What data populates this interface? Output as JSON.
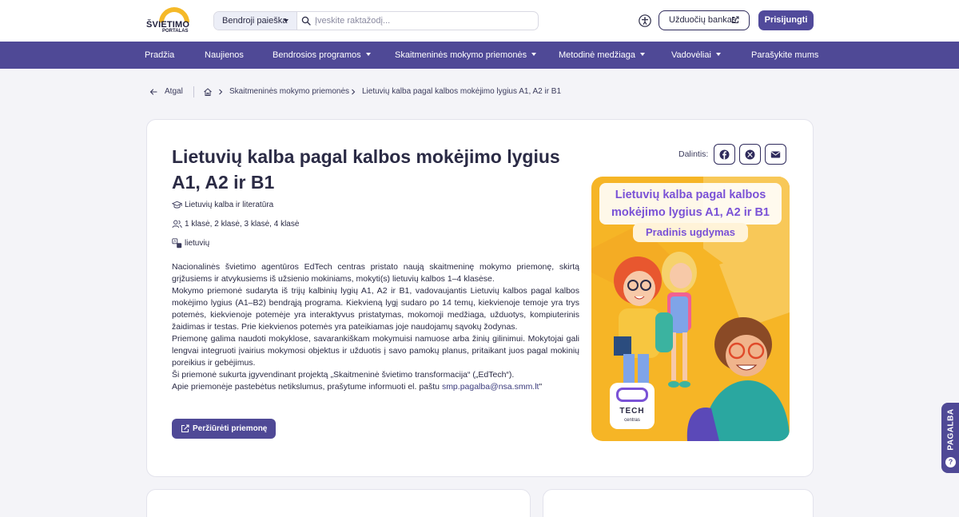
{
  "header": {
    "logo_text_main": "ŠVIETIMO",
    "logo_text_sub": "PORTALAS",
    "search_scope": "Bendroji paieška",
    "search_placeholder": "Įveskite raktažodį...",
    "task_bank_label": "Užduočių bankas",
    "login_label": "Prisijungti"
  },
  "nav": {
    "items": [
      {
        "label": "Pradžia"
      },
      {
        "label": "Naujienos"
      },
      {
        "label": "Bendrosios programos"
      },
      {
        "label": "Skaitmeninės mokymo priemonės"
      },
      {
        "label": "Metodinė medžiaga"
      },
      {
        "label": "Vadovėliai"
      },
      {
        "label": "Parašykite mums"
      }
    ]
  },
  "breadcrumb": {
    "back_label": "Atgal",
    "level1": "Skaitmeninės mokymo priemonės",
    "current": "Lietuvių kalba pagal kalbos mokėjimo lygius A1, A2 ir B1"
  },
  "resource": {
    "title": "Lietuvių kalba pagal kalbos mokėjimo lygius A1, A2 ir B1",
    "subject": "Lietuvių kalba ir literatūra",
    "grades": "1 klasė, 2 klasė, 3 klasė, 4 klasė",
    "language": "lietuvių",
    "description": [
      "Nacionalinės švietimo agentūros EdTech centras pristato naują skaitmeninę mokymo priemonę, skirtą grįžusiems ir atvykusiems iš užsienio mokiniams, mokyti(s) lietuvių kalbos 1–4 klasėse.",
      "Mokymo priemonė sudaryta iš trijų kalbinių lygių A1, A2 ir B1, vadovaujantis Lietuvių kalbos pagal kalbos mokėjimo lygius (A1–B2) bendrąją programa. Kiekvieną lygį sudaro po 14 temų, kiekvienoje temoje yra trys potemės, kiekvienoje potemėje yra interaktyvus pristatymas, mokomoji medžiaga, užduotys, kompiuterinis žaidimas ir testas. Prie kiekvienos potemės yra pateikiamas joje naudojamų sąvokų žodynas.",
      "Priemonę galima naudoti mokyklose, savarankiškam mokymuisi namuose arba žinių gilinimui. Mokytojai gali lengvai integruoti įvairius mokymosi objektus ir užduotis į savo pamokų planus, pritaikant juos pagal mokinių poreikius ir gebėjimus.",
      "Ši priemonė sukurta įgyvendinant projektą „Skaitmeninė švietimo transformacija“ („EdTech“)."
    ],
    "contact_text": "Apie priemonėje pastebėtus netikslumus, prašytume informuoti el. paštu ",
    "contact_email": "smp.pagalba@nsa.smm.lt",
    "contact_suffix": "\"",
    "view_button": "Peržiūrėti priemonę",
    "share_label": "Dalintis:"
  },
  "poster": {
    "title": "Lietuvių kalba pagal kalbos mokėjimo lygius A1, A2 ir B1",
    "subtitle": "Pradinis ugdymas",
    "badge_main": "TECH",
    "badge_sub": "centras"
  },
  "help_tab": {
    "label": "PAGALBA",
    "icon_glyph": "?"
  },
  "colors": {
    "brand_purple": "#4f4996",
    "logo_yellow": "#f5b928",
    "poster_orange": "#f6b526",
    "poster_text": "#7a52d6"
  }
}
